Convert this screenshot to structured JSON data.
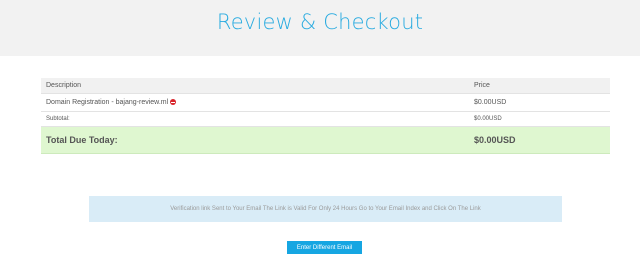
{
  "header": {
    "title": "Review & Checkout"
  },
  "cart": {
    "columns": {
      "description": "Description",
      "price": "Price"
    },
    "item": {
      "description": "Domain Registration - bajang-review.ml",
      "price": "$0.00USD"
    },
    "subtotal": {
      "label": "Subtotal:",
      "value": "$0.00USD"
    },
    "total": {
      "label": "Total Due Today:",
      "value": "$0.00USD"
    }
  },
  "alert": {
    "text": "Verification link Sent to Your Email The Link is Valid For Only 24 Hours Go to Your Email Index and Click On The Link"
  },
  "actions": {
    "enter_email_label": "Enter Different Email"
  },
  "icons": {
    "remove": "remove-circle-icon"
  },
  "colors": {
    "accent": "#29abe0",
    "total_bg": "#dff7d0",
    "alert_bg": "#d9ecf7",
    "button_bg": "#16a6e2",
    "remove": "#d8232a"
  }
}
